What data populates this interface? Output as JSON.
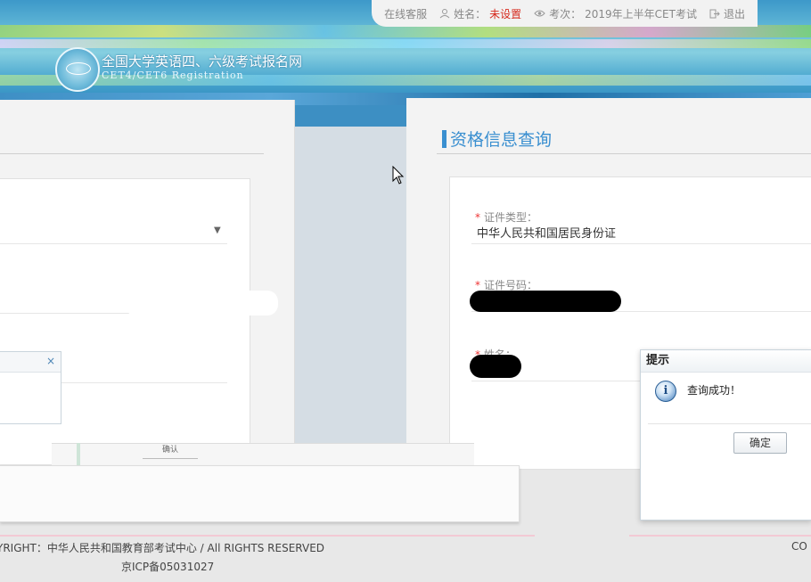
{
  "header": {
    "site_title": "全国大学英语四、六级考试报名网",
    "site_subtitle": "CET4/CET6  Registration",
    "topbar": {
      "online_service": "在线客服",
      "name_label": "姓名：",
      "name_value": "未设置",
      "exam_label": "考次：",
      "exam_value": "2019年上半年CET考试",
      "logout": "退出"
    }
  },
  "query_panel": {
    "title": "资格信息查询",
    "fields": [
      {
        "label": "证件类型：",
        "value": "中华人民共和国居民身份证"
      },
      {
        "label": "证件号码：",
        "value": ""
      },
      {
        "label": "姓名：",
        "value": ""
      }
    ]
  },
  "left_dialog": {
    "close_icon": "×",
    "button_fragment": "确认"
  },
  "prompt_dialog": {
    "title": "提示",
    "message": "查询成功！",
    "icon": "info-icon",
    "ok_label": "确定"
  },
  "footer": {
    "copyright": "YRIGHT：中华人民共和国教育部考试中心 / All RIGHTS RESERVED",
    "icp": "京ICP备05031027",
    "right_fragment": "CO"
  },
  "colors": {
    "accent": "#3a8fd0",
    "required_star": "#e33333",
    "warn": "#d62a1e"
  }
}
